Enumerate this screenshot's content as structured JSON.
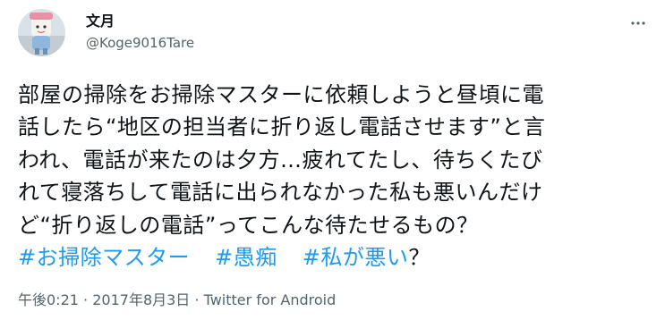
{
  "user": {
    "display_name": "文月",
    "handle": "@Koge9016Tare",
    "avatar_icon": "avatar-mascot-icon"
  },
  "menu": {
    "icon": "more-horizontal-icon",
    "glyph": "···"
  },
  "tweet": {
    "lines": [
      "部屋の掃除をお掃除マスターに依頼しようと昼頃に電",
      "話したら“地区の担当者に折り返し電話させます”と言",
      "われ、電話が来たのは夕方…疲れてたし、待ちくたび",
      "れて寝落ちして電話に出られなかった私も悪いんだけ",
      "ど“折り返しの電話”ってこんな待たせるもの？"
    ],
    "hashtags": [
      "#お掃除マスター",
      "#愚痴",
      "#私が悪い"
    ],
    "trailing": "？"
  },
  "meta": {
    "time": "午後0:21",
    "separator": "·",
    "date": "2017年8月3日",
    "source": "Twitter for Android"
  },
  "colors": {
    "link": "#1d9bf0",
    "muted": "#536471",
    "text": "#0f1419"
  }
}
